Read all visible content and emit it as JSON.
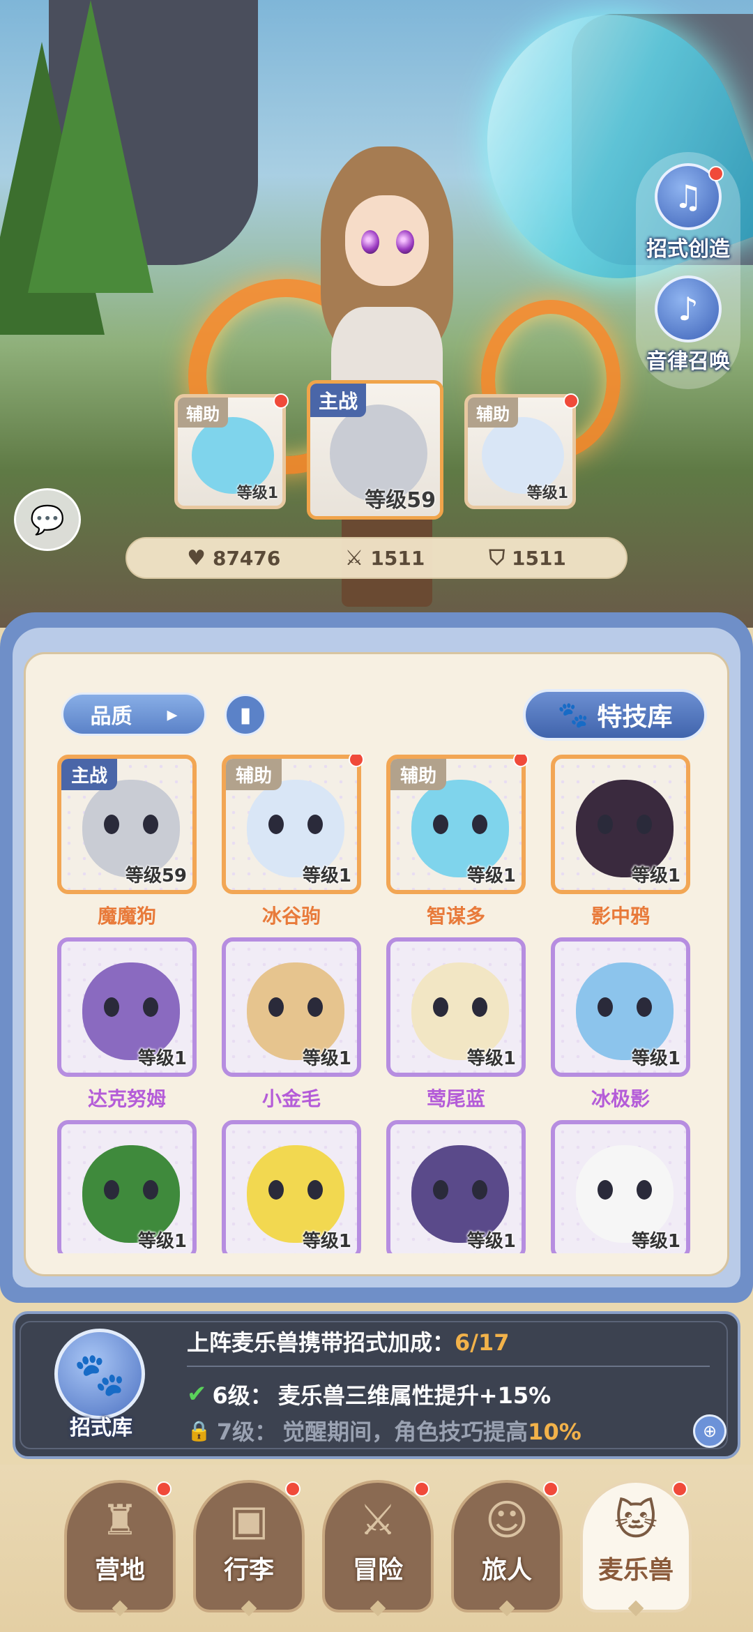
{
  "side_buttons": {
    "create": {
      "label": "招式创造",
      "icon": "music-book-icon"
    },
    "summon": {
      "label": "音律召唤",
      "icon": "lyre-icon"
    }
  },
  "formation": {
    "left": {
      "tag": "辅助",
      "level": "等级1"
    },
    "center": {
      "tag": "主战",
      "level": "等级59"
    },
    "right": {
      "tag": "辅助",
      "level": "等级1"
    }
  },
  "stats": {
    "hp": "87476",
    "attack": "1511",
    "defense": "1511"
  },
  "toolbar": {
    "quality": "品质",
    "quality_arrow": "▸",
    "skill_library": "特技库"
  },
  "pets": [
    {
      "name": "魔魔狗",
      "tag": "主战",
      "level": "等级59",
      "rarity": "orange",
      "color": "#c9ccd4",
      "dot": false
    },
    {
      "name": "冰谷驹",
      "tag": "辅助",
      "level": "等级1",
      "rarity": "orange",
      "color": "#d9e6f6",
      "dot": true
    },
    {
      "name": "智谋多",
      "tag": "辅助",
      "level": "等级1",
      "rarity": "orange",
      "color": "#7fd4ec",
      "dot": true
    },
    {
      "name": "影中鸦",
      "tag": "",
      "level": "等级1",
      "rarity": "orange",
      "color": "#3a2a3e",
      "dot": false
    },
    {
      "name": "达克努姆",
      "tag": "",
      "level": "等级1",
      "rarity": "purple",
      "color": "#8a6ac0",
      "dot": false
    },
    {
      "name": "小金毛",
      "tag": "",
      "level": "等级1",
      "rarity": "purple",
      "color": "#e6c48e",
      "dot": false
    },
    {
      "name": "莺尾蓝",
      "tag": "",
      "level": "等级1",
      "rarity": "purple",
      "color": "#f2e6c4",
      "dot": false
    },
    {
      "name": "冰极影",
      "tag": "",
      "level": "等级1",
      "rarity": "purple",
      "color": "#8cc4ec",
      "dot": false
    },
    {
      "name": "",
      "tag": "",
      "level": "等级1",
      "rarity": "purple",
      "color": "#3f8a3c",
      "dot": false
    },
    {
      "name": "",
      "tag": "",
      "level": "等级1",
      "rarity": "purple",
      "color": "#f2d850",
      "dot": false
    },
    {
      "name": "",
      "tag": "",
      "level": "等级1",
      "rarity": "purple",
      "color": "#5a4a8a",
      "dot": false
    },
    {
      "name": "",
      "tag": "",
      "level": "等级1",
      "rarity": "purple",
      "color": "#f6f6f6",
      "dot": false
    }
  ],
  "bonus": {
    "icon_label": "招式库",
    "title": "上阵麦乐兽携带招式加成：",
    "progress": "6/17",
    "line1_level": "6级：",
    "line1_text": "麦乐兽三维属性提升+15%",
    "line2_level": "7级：",
    "line2_text": "觉醒期间，角色技巧提高",
    "line2_value": "10%"
  },
  "nav": [
    {
      "label": "营地",
      "icon": "castle-icon",
      "active": false
    },
    {
      "label": "行李",
      "icon": "chest-icon",
      "active": false
    },
    {
      "label": "冒险",
      "icon": "crossed-swords-icon",
      "active": false
    },
    {
      "label": "旅人",
      "icon": "character-icon",
      "active": false
    },
    {
      "label": "麦乐兽",
      "icon": "pet-cat-icon",
      "active": true
    }
  ],
  "colors": {
    "orange_rarity": "#f2a654",
    "purple_rarity": "#b68de0",
    "accent_blue": "#4a66a8",
    "highlight": "#f2b24a"
  }
}
